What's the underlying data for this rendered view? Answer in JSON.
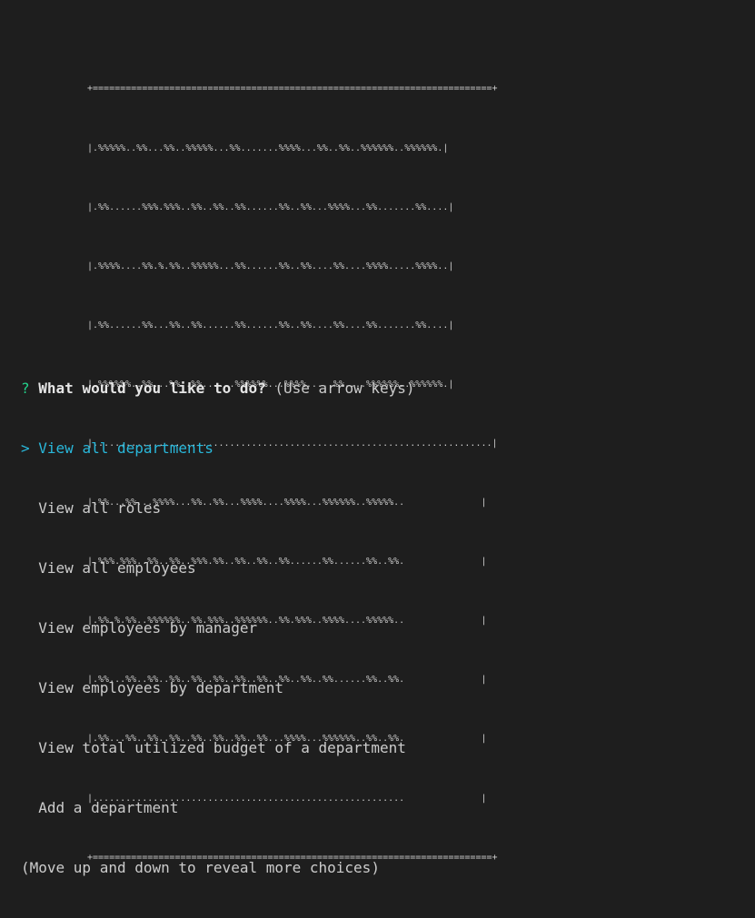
{
  "banner": {
    "lines": [
      "+=========================================================================+",
      "|.%%%%%..%%...%%..%%%%%...%%.......%%%%...%%..%%..%%%%%%..%%%%%%.|",
      "|.%%......%%%.%%%..%%..%%..%%......%%..%%...%%%%...%%.......%%....|",
      "|.%%%%....%%.%.%%..%%%%%...%%......%%..%%....%%....%%%%.....%%%%..|",
      "|.%%......%%...%%..%%......%%......%%..%%....%%....%%.......%%....|",
      "|.%%%%%%..%%...%%..%%......%%%%%%...%%%%.....%%....%%%%%%..%%%%%%.|",
      "|.........................................................................|",
      "|.%%...%%...%%%%...%%..%%...%%%%....%%%%...%%%%%%..%%%%%..              |",
      "|.%%%.%%%..%%..%%..%%%.%%..%%..%%..%%......%%......%%..%%.              |",
      "|.%%.%.%%..%%%%%%..%%.%%%..%%%%%%..%%.%%%..%%%%....%%%%%..              |",
      "|.%%...%%..%%..%%..%%..%%..%%..%%..%%..%%..%%......%%..%%.              |",
      "|.%%...%%..%%..%%..%%..%%..%%..%%...%%%%...%%%%%%..%%..%%.              |",
      "|.........................................................              |",
      "+=========================================================================+"
    ]
  },
  "prompt": {
    "mark": "?",
    "question": "What would you like to do?",
    "hint": "(Use arrow keys)"
  },
  "pointer": ">",
  "choices": [
    "View all departments",
    "View all roles",
    "View all employees",
    "View employees by manager",
    "View employees by department",
    "View total utilized budget of a department",
    "Add a department"
  ],
  "footer": "(Move up and down to reveal more choices)",
  "colors": {
    "background": "#1e1e1e",
    "text": "#cccccc",
    "prompt_mark": "#23d18b",
    "selected": "#29b8db"
  }
}
